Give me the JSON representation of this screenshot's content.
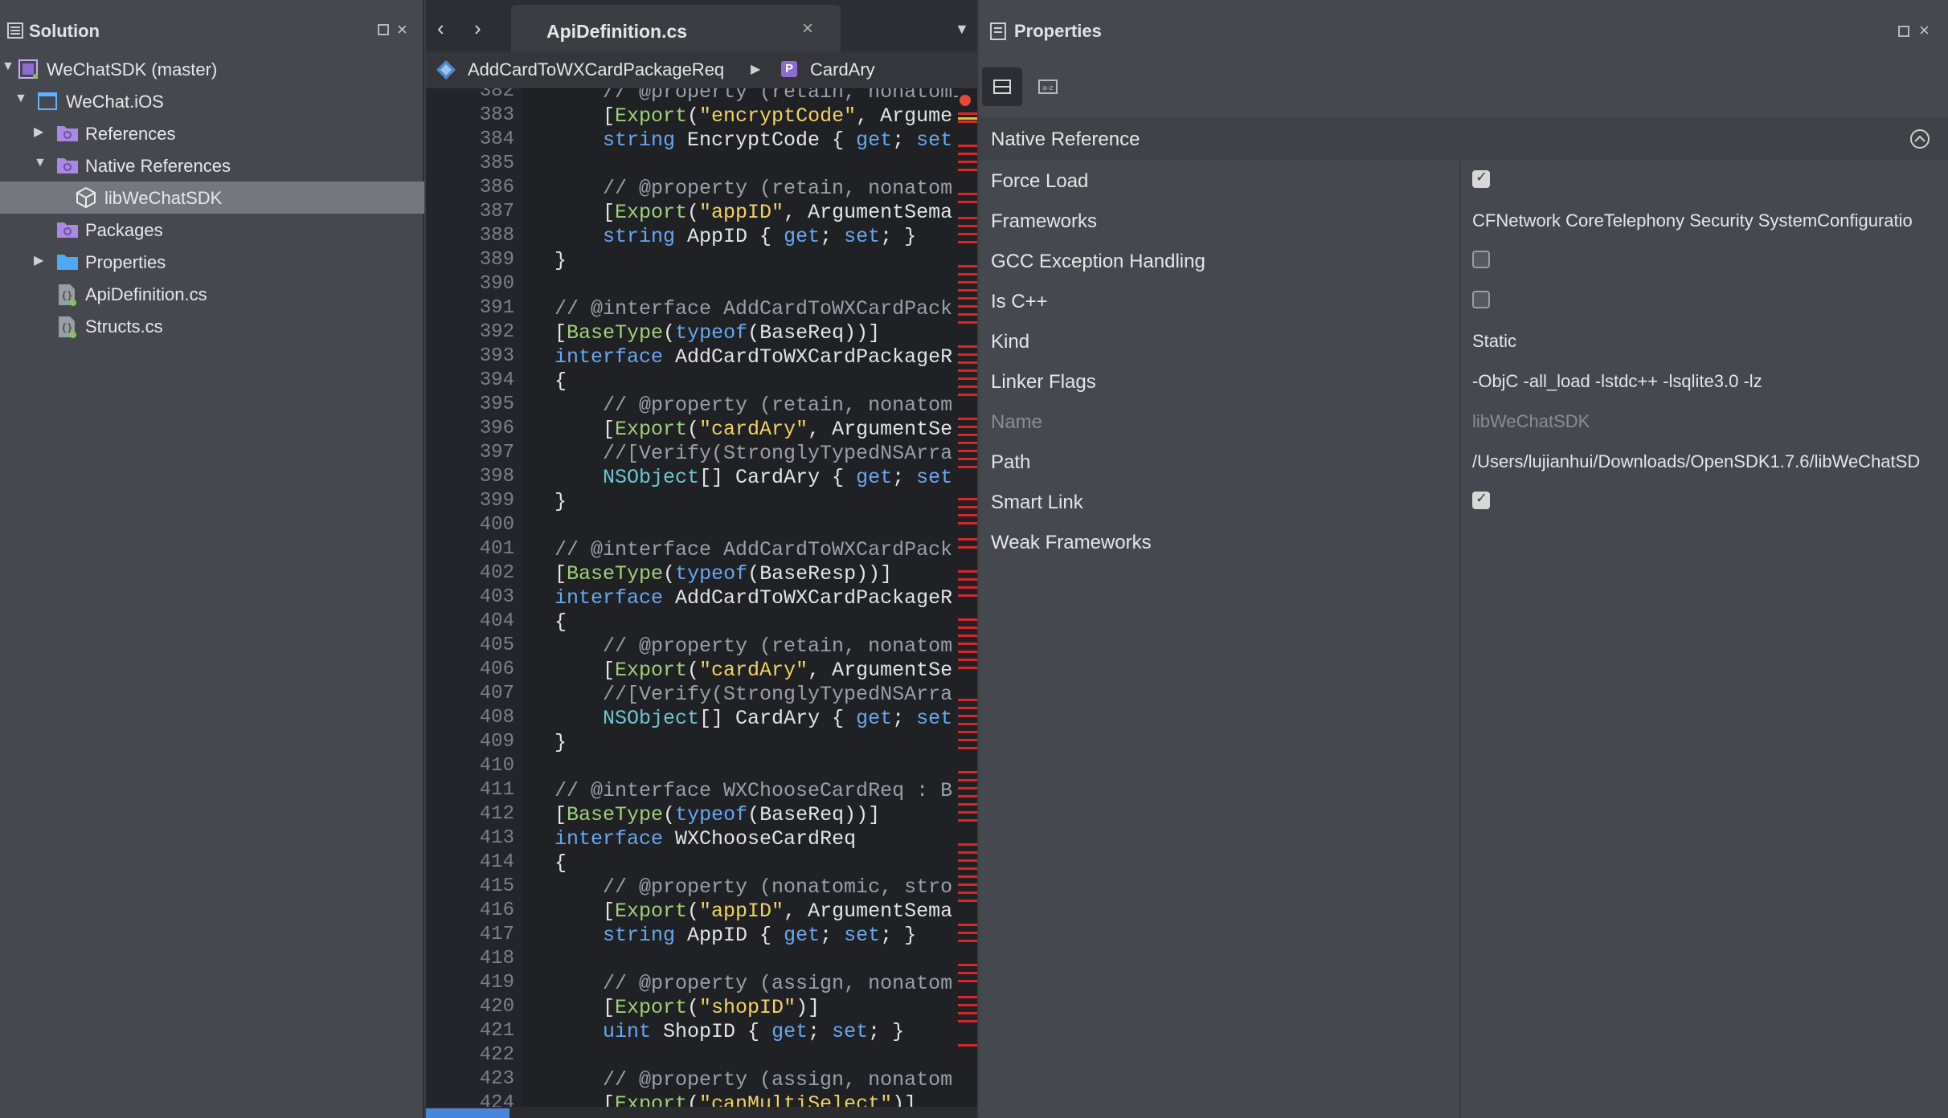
{
  "solution": {
    "title": "Solution",
    "items": [
      {
        "label": "WeChatSDK (master)"
      },
      {
        "label": "WeChat.iOS"
      },
      {
        "label": "References"
      },
      {
        "label": "Native References"
      },
      {
        "label": "libWeChatSDK"
      },
      {
        "label": "Packages"
      },
      {
        "label": "Properties"
      },
      {
        "label": "ApiDefinition.cs"
      },
      {
        "label": "Structs.cs"
      }
    ]
  },
  "editor": {
    "tab_label": "ApiDefinition.cs",
    "breadcrumb": {
      "class_name": "AddCardToWXCardPackageReq",
      "member_badge": "P",
      "member_name": "CardAry"
    },
    "lines": [
      {
        "n": "382",
        "t": "    // @property (retain, nonatomic"
      },
      {
        "n": "383",
        "t": "    [Export(\"encryptCode\", Argume"
      },
      {
        "n": "384",
        "t": "    string EncryptCode { get; set"
      },
      {
        "n": "385",
        "t": ""
      },
      {
        "n": "386",
        "t": "    // @property (retain, nonatom"
      },
      {
        "n": "387",
        "t": "    [Export(\"appID\", ArgumentSema"
      },
      {
        "n": "388",
        "t": "    string AppID { get; set; }"
      },
      {
        "n": "389",
        "t": "}"
      },
      {
        "n": "390",
        "t": ""
      },
      {
        "n": "391",
        "t": "// @interface AddCardToWXCardPack"
      },
      {
        "n": "392",
        "t": "[BaseType(typeof(BaseReq))]"
      },
      {
        "n": "393",
        "t": "interface AddCardToWXCardPackageR"
      },
      {
        "n": "394",
        "t": "{"
      },
      {
        "n": "395",
        "t": "    // @property (retain, nonatom"
      },
      {
        "n": "396",
        "t": "    [Export(\"cardAry\", ArgumentSe"
      },
      {
        "n": "397",
        "t": "    //[Verify(StronglyTypedNSArra"
      },
      {
        "n": "398",
        "t": "    NSObject[] CardAry { get; set"
      },
      {
        "n": "399",
        "t": "}"
      },
      {
        "n": "400",
        "t": ""
      },
      {
        "n": "401",
        "t": "// @interface AddCardToWXCardPack"
      },
      {
        "n": "402",
        "t": "[BaseType(typeof(BaseResp))]"
      },
      {
        "n": "403",
        "t": "interface AddCardToWXCardPackageR"
      },
      {
        "n": "404",
        "t": "{"
      },
      {
        "n": "405",
        "t": "    // @property (retain, nonatom"
      },
      {
        "n": "406",
        "t": "    [Export(\"cardAry\", ArgumentSe"
      },
      {
        "n": "407",
        "t": "    //[Verify(StronglyTypedNSArra"
      },
      {
        "n": "408",
        "t": "    NSObject[] CardAry { get; set"
      },
      {
        "n": "409",
        "t": "}"
      },
      {
        "n": "410",
        "t": ""
      },
      {
        "n": "411",
        "t": "// @interface WXChooseCardReq : B"
      },
      {
        "n": "412",
        "t": "[BaseType(typeof(BaseReq))]"
      },
      {
        "n": "413",
        "t": "interface WXChooseCardReq"
      },
      {
        "n": "414",
        "t": "{"
      },
      {
        "n": "415",
        "t": "    // @property (nonatomic, stro"
      },
      {
        "n": "416",
        "t": "    [Export(\"appID\", ArgumentSema"
      },
      {
        "n": "417",
        "t": "    string AppID { get; set; }"
      },
      {
        "n": "418",
        "t": ""
      },
      {
        "n": "419",
        "t": "    // @property (assign, nonatom"
      },
      {
        "n": "420",
        "t": "    [Export(\"shopID\")]"
      },
      {
        "n": "421",
        "t": "    uint ShopID { get; set; }"
      },
      {
        "n": "422",
        "t": ""
      },
      {
        "n": "423",
        "t": "    // @property (assign, nonatom"
      },
      {
        "n": "424",
        "t": "    [Export(\"canMultiSelect\")]"
      }
    ]
  },
  "properties": {
    "title": "Properties",
    "section": "Native Reference",
    "rows": [
      {
        "name": "Force Load",
        "kind": "check",
        "checked": true
      },
      {
        "name": "Frameworks",
        "kind": "text",
        "value": "CFNetwork CoreTelephony Security SystemConfiguratio"
      },
      {
        "name": "GCC Exception Handling",
        "kind": "check",
        "checked": false
      },
      {
        "name": "Is C++",
        "kind": "check",
        "checked": false
      },
      {
        "name": "Kind",
        "kind": "text",
        "value": "Static"
      },
      {
        "name": "Linker Flags",
        "kind": "text",
        "value": "-ObjC -all_load -lstdc++ -lsqlite3.0 -lz"
      },
      {
        "name": "Name",
        "kind": "text",
        "value": "libWeChatSDK",
        "disabled": true
      },
      {
        "name": "Path",
        "kind": "text",
        "value": "/Users/lujianhui/Downloads/OpenSDK1.7.6/libWeChatSD"
      },
      {
        "name": "Smart Link",
        "kind": "check",
        "checked": true
      },
      {
        "name": "Weak Frameworks",
        "kind": "text",
        "value": ""
      }
    ]
  }
}
